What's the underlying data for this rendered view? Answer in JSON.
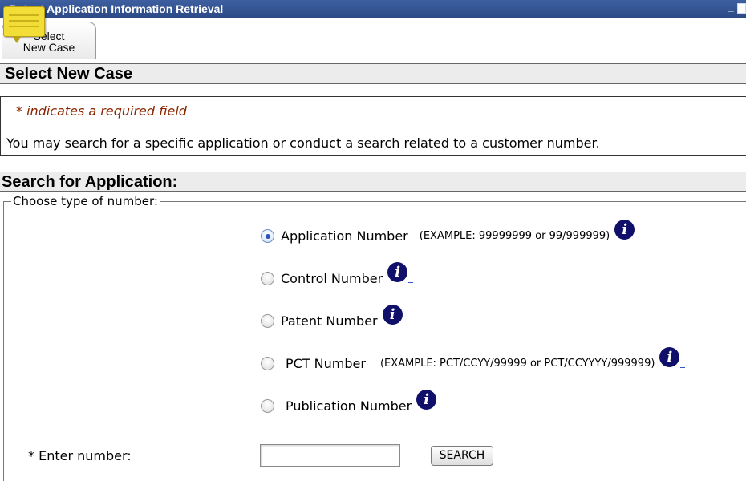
{
  "window": {
    "title": "Patent Application Information Retrieval"
  },
  "tabs": [
    {
      "line1": "Select",
      "line2": "New Case"
    }
  ],
  "section1": {
    "heading": "Select New Case",
    "required_note": "* indicates a required field",
    "intro": "You may search for a specific application or conduct a search related to a customer number."
  },
  "section2": {
    "heading": "Search for Application:",
    "legend": "Choose type of number:",
    "options": [
      {
        "label": "Application Number",
        "example": "(EXAMPLE: 99999999 or 99/999999)",
        "selected": true
      },
      {
        "label": "Control Number",
        "example": "",
        "selected": false
      },
      {
        "label": "Patent Number",
        "example": "",
        "selected": false
      },
      {
        "label": "PCT Number",
        "example": "(EXAMPLE: PCT/CCYY/99999 or PCT/CCYYYY/999999)",
        "selected": false
      },
      {
        "label": "Publication Number",
        "example": "",
        "selected": false
      }
    ],
    "info_icon_glyph": "i",
    "enter_label": "* Enter number:",
    "number_value": "",
    "search_button": "SEARCH"
  },
  "colors": {
    "titlebar": "#2c4a86",
    "required_text": "#8b2500",
    "info_icon": "#10106a",
    "sticky_note": "#f3dd37"
  }
}
